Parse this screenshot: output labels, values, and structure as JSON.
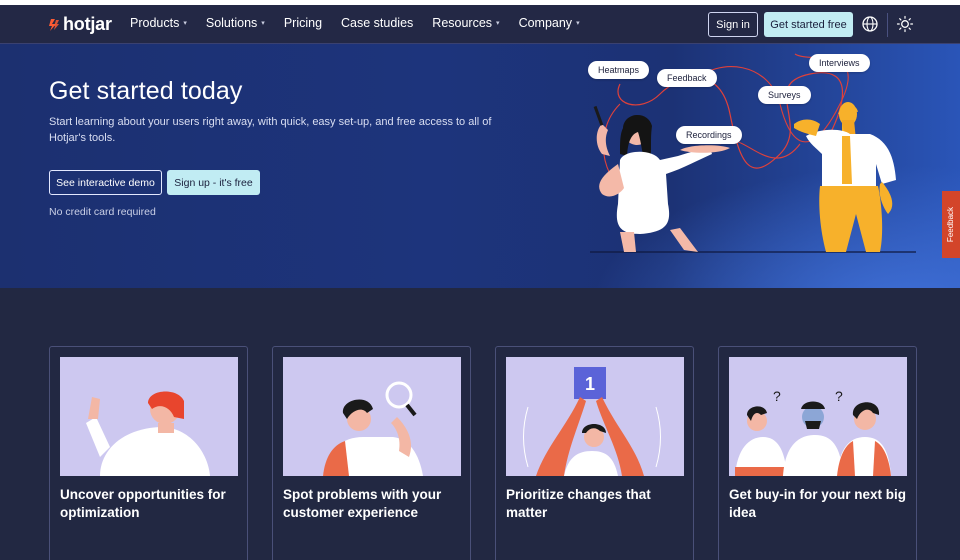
{
  "nav": {
    "logo": "hotjar",
    "menu": [
      {
        "label": "Products",
        "caret": true
      },
      {
        "label": "Solutions",
        "caret": true
      },
      {
        "label": "Pricing",
        "caret": false
      },
      {
        "label": "Case studies",
        "caret": false
      },
      {
        "label": "Resources",
        "caret": true
      },
      {
        "label": "Company",
        "caret": true
      }
    ],
    "signin": "Sign in",
    "get_started": "Get started free",
    "icons": [
      "globe-icon",
      "sun-icon"
    ]
  },
  "hero": {
    "title": "Get started today",
    "subtitle": "Start learning about your users right away, with quick, easy set-up, and free access to all of Hotjar's tools.",
    "demo_button": "See interactive demo",
    "signup_button": "Sign up - it's free",
    "note": "No credit card required",
    "pills": [
      "Heatmaps",
      "Feedback",
      "Recordings",
      "Surveys",
      "Interviews"
    ]
  },
  "feedback_tab": "Feedback",
  "cards": [
    {
      "title": "Uncover opportunities for optimization"
    },
    {
      "title": "Spot problems with your customer experience"
    },
    {
      "title": "Prioritize changes that matter",
      "badge": "1"
    },
    {
      "title": "Get buy-in for your next big idea"
    }
  ],
  "colors": {
    "brand_orange": "#fd5b33",
    "nav_bg": "#232845",
    "hero_blue": "#1d347c",
    "accent_cyan": "#c1ecf3",
    "card_illustration_bg": "#cdc8f0",
    "feedback_tab": "#d3452a"
  }
}
